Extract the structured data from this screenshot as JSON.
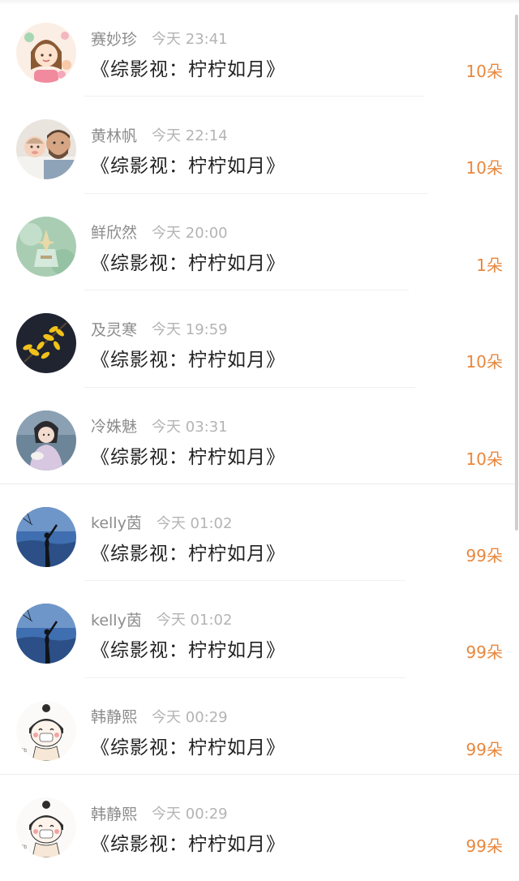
{
  "records": [
    {
      "name": "赛妙珍",
      "time": "今天 23:41",
      "title": "《综影视：柠柠如月》",
      "amount": "10朵",
      "avatar": "avatar-cartoon-girl"
    },
    {
      "name": "黄林帆",
      "time": "今天 22:14",
      "title": "《综影视：柠柠如月》",
      "amount": "10朵",
      "avatar": "avatar-father-baby-photo"
    },
    {
      "name": "鲜欣然",
      "time": "今天 20:00",
      "title": "《综影视：柠柠如月》",
      "amount": "1朵",
      "avatar": "avatar-green-perfume"
    },
    {
      "name": "及灵寒",
      "time": "今天 19:59",
      "title": "《综影视：柠柠如月》",
      "amount": "10朵",
      "avatar": "avatar-yellow-flowers"
    },
    {
      "name": "冷姝魅",
      "time": "今天 03:31",
      "title": "《综影视：柠柠如月》",
      "amount": "10朵",
      "avatar": "avatar-costume-woman"
    },
    {
      "name": "kelly茵",
      "time": "今天 01:02",
      "title": "《综影视：柠柠如月》",
      "amount": "99朵",
      "avatar": "avatar-silhouette-sky"
    },
    {
      "name": "kelly茵",
      "time": "今天 01:02",
      "title": "《综影视：柠柠如月》",
      "amount": "99朵",
      "avatar": "avatar-silhouette-sky"
    },
    {
      "name": "韩静熙",
      "time": "今天 00:29",
      "title": "《综影视：柠柠如月》",
      "amount": "99朵",
      "avatar": "avatar-cartoon-mask-girl"
    },
    {
      "name": "韩静熙",
      "time": "今天 00:29",
      "title": "《综影视：柠柠如月》",
      "amount": "99朵",
      "avatar": "avatar-cartoon-mask-girl"
    }
  ],
  "colors": {
    "amount": "#e8873c",
    "name": "#8c8c8c",
    "time": "#b4b4b4",
    "title": "#222222"
  }
}
